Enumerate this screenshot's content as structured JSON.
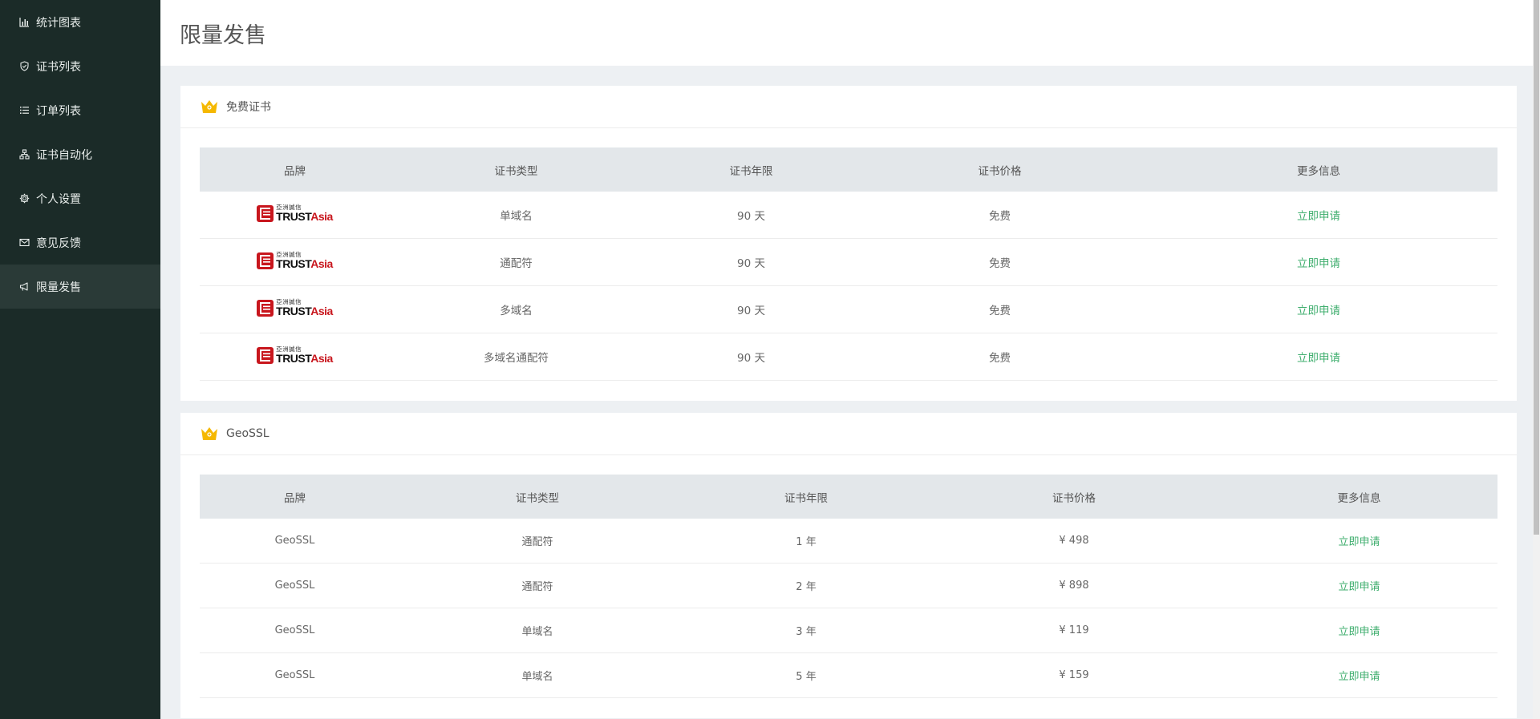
{
  "sidebar": {
    "items": [
      {
        "label": "统计图表",
        "icon": "bar-chart-icon"
      },
      {
        "label": "证书列表",
        "icon": "shield-icon"
      },
      {
        "label": "订单列表",
        "icon": "list-icon"
      },
      {
        "label": "证书自动化",
        "icon": "sitemap-icon"
      },
      {
        "label": "个人设置",
        "icon": "gear-icon"
      },
      {
        "label": "意见反馈",
        "icon": "envelope-icon"
      },
      {
        "label": "限量发售",
        "icon": "megaphone-icon"
      }
    ]
  },
  "page": {
    "title": "限量发售"
  },
  "free_card": {
    "title": "免费证书",
    "headers": [
      "品牌",
      "证书类型",
      "证书年限",
      "证书价格",
      "更多信息"
    ],
    "logo": {
      "cn": "亞洲誠信",
      "en_black": "TRUST",
      "en_red": "Asia"
    },
    "rows": [
      {
        "type": "单域名",
        "term": "90 天",
        "price": "免费",
        "action": "立即申请"
      },
      {
        "type": "通配符",
        "term": "90 天",
        "price": "免费",
        "action": "立即申请"
      },
      {
        "type": "多域名",
        "term": "90 天",
        "price": "免费",
        "action": "立即申请"
      },
      {
        "type": "多域名通配符",
        "term": "90 天",
        "price": "免费",
        "action": "立即申请"
      }
    ]
  },
  "geossl_card": {
    "title": "GeoSSL",
    "headers": [
      "品牌",
      "证书类型",
      "证书年限",
      "证书价格",
      "更多信息"
    ],
    "rows": [
      {
        "brand": "GeoSSL",
        "type": "通配符",
        "term": "1 年",
        "price": "¥ 498",
        "action": "立即申请"
      },
      {
        "brand": "GeoSSL",
        "type": "通配符",
        "term": "2 年",
        "price": "¥ 898",
        "action": "立即申请"
      },
      {
        "brand": "GeoSSL",
        "type": "单域名",
        "term": "3 年",
        "price": "¥ 119",
        "action": "立即申请"
      },
      {
        "brand": "GeoSSL",
        "type": "单域名",
        "term": "5 年",
        "price": "¥ 159",
        "action": "立即申请"
      }
    ]
  },
  "colors": {
    "sidebar": "#1b2b28",
    "accent": "#3fae6e",
    "crown": "#f5b800",
    "logo_red": "#c8161d"
  }
}
